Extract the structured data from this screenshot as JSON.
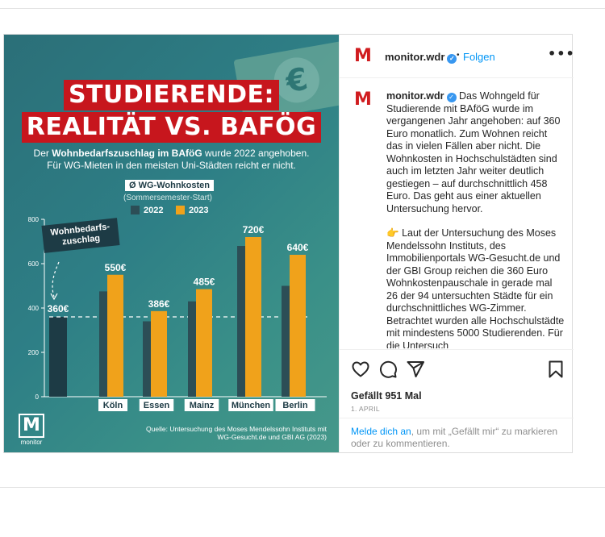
{
  "post": {
    "username": "monitor.wdr",
    "follow_label": "Folgen",
    "caption_p1": "Das Wohngeld für Studierende mit BAföG wurde im vergangenen Jahr angehoben: auf 360 Euro monatlich. Zum Wohnen reicht das in vielen Fällen aber nicht. Die Wohnkosten in Hochschulstädten sind auch im letzten Jahr weiter deutlich gestiegen – auf durchschnittlich 458 Euro. Das geht aus einer aktuellen Untersuchung hervor.",
    "caption_p2": "Laut der Untersuchung des Moses Mendelssohn Instituts, des Immobilienportals WG-Gesucht.de und der GBI Group reichen die 360 Euro Wohnkostenpauschale in gerade mal 26 der 94 untersuchten Städte für ein durchschnittliches WG-Zimmer. Betrachtet wurden alle Hochschulstädte mit mindestens 5000 Studierenden. Für die Untersuch",
    "caption_emoji": "👉",
    "likes": "Gefällt 951 Mal",
    "date": "1. APRIL",
    "login_link": "Melde dich an",
    "login_rest": ", um mit „Gefällt mir“ zu markieren oder zu kommentieren."
  },
  "image": {
    "title_line1": "STUDIERENDE:",
    "title_line2": "REALITÄT VS. BAFÖG",
    "subtitle_pre": "Der ",
    "subtitle_bold": "Wohnbedarfszuschlag im BAföG",
    "subtitle_post": " wurde 2022 angehoben.",
    "subtitle_line2": "Für WG-Mieten in den meisten Uni-Städten reicht er nicht.",
    "legend_title": "Ø WG-Wohnkosten",
    "legend_sub": "(Sommersemester-Start)",
    "legend_2022": "2022",
    "legend_2023": "2023",
    "callout": "Wohnbedarfs-zuschlag",
    "baseline_label": "360€",
    "footnote": "Quelle: Untersuchung des Moses Mendelssohn Instituts mit WG-Gesucht.de und GBI AG (2023)",
    "logo_letter": "M",
    "logo_text": "monitor",
    "euro_symbol": "€"
  },
  "chart_data": {
    "type": "bar",
    "categories": [
      "Köln",
      "Essen",
      "Mainz",
      "München",
      "Berlin"
    ],
    "series": [
      {
        "name": "2022",
        "values": [
          475,
          340,
          430,
          680,
          500
        ],
        "color": "#2c4e56"
      },
      {
        "name": "2023",
        "values": [
          550,
          386,
          485,
          720,
          640
        ],
        "color": "#f0a21b"
      }
    ],
    "data_labels_2023": [
      "550€",
      "386€",
      "485€",
      "720€",
      "640€"
    ],
    "reference": {
      "value": 360,
      "label": "360€",
      "color": "#1d3b45"
    },
    "yticks": [
      0,
      200,
      400,
      600,
      800
    ],
    "ylim": [
      0,
      800
    ],
    "title": "Ø WG-Wohnkosten",
    "subtitle": "(Sommersemester-Start)",
    "grid": false,
    "legend": "top"
  },
  "colors": {
    "accent_red": "#c7161d",
    "link_blue": "#0095f6",
    "bar_2023": "#f0a21b",
    "bar_2022": "#2c4e56"
  },
  "icons": {
    "like": "heart-icon",
    "comment": "comment-icon",
    "share": "send-icon",
    "save": "bookmark-icon",
    "more": "more-options-icon",
    "verified": "verified-badge-icon"
  }
}
